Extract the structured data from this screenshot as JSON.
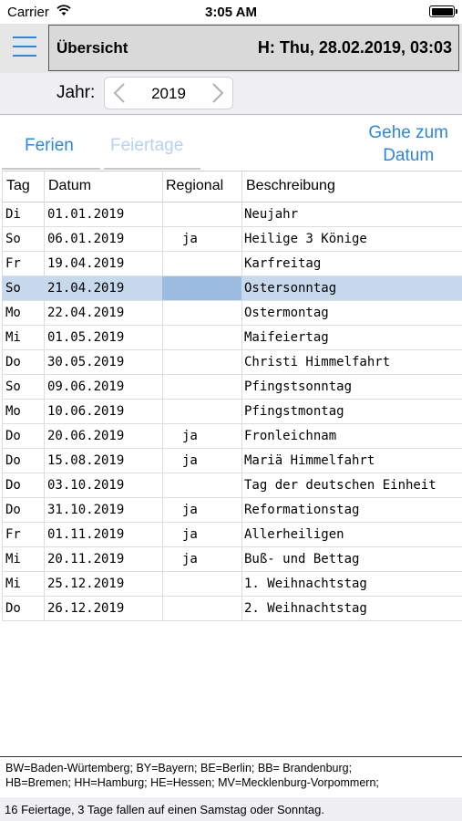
{
  "status": {
    "carrier": "Carrier",
    "time": "3:05 AM"
  },
  "header": {
    "title": "Übersicht",
    "datetime": "H: Thu, 28.02.2019, 03:03"
  },
  "year": {
    "label": "Jahr:",
    "value": "2019"
  },
  "tabs": {
    "ferien": "Ferien",
    "feiertage": "Feiertage",
    "goto_line1": "Gehe zum",
    "goto_line2": "Datum"
  },
  "table": {
    "headers": [
      "Tag",
      "Datum",
      "Regional",
      "Beschreibung"
    ],
    "rows": [
      {
        "tag": "Di",
        "datum": "01.01.2019",
        "regional": "",
        "beschreibung": "Neujahr"
      },
      {
        "tag": "So",
        "datum": "06.01.2019",
        "regional": "ja",
        "beschreibung": "Heilige 3 Könige"
      },
      {
        "tag": "Fr",
        "datum": "19.04.2019",
        "regional": "",
        "beschreibung": "Karfreitag"
      },
      {
        "tag": "So",
        "datum": "21.04.2019",
        "regional": "",
        "beschreibung": "Ostersonntag"
      },
      {
        "tag": "Mo",
        "datum": "22.04.2019",
        "regional": "",
        "beschreibung": "Ostermontag"
      },
      {
        "tag": "Mi",
        "datum": "01.05.2019",
        "regional": "",
        "beschreibung": "Maifeiertag"
      },
      {
        "tag": "Do",
        "datum": "30.05.2019",
        "regional": "",
        "beschreibung": "Christi Himmelfahrt"
      },
      {
        "tag": "So",
        "datum": "09.06.2019",
        "regional": "",
        "beschreibung": "Pfingstsonntag"
      },
      {
        "tag": "Mo",
        "datum": "10.06.2019",
        "regional": "",
        "beschreibung": "Pfingstmontag"
      },
      {
        "tag": "Do",
        "datum": "20.06.2019",
        "regional": "ja",
        "beschreibung": "Fronleichnam"
      },
      {
        "tag": "Do",
        "datum": "15.08.2019",
        "regional": "ja",
        "beschreibung": "Mariä Himmelfahrt"
      },
      {
        "tag": "Do",
        "datum": "03.10.2019",
        "regional": "",
        "beschreibung": "Tag der deutschen Einheit"
      },
      {
        "tag": "Do",
        "datum": "31.10.2019",
        "regional": "ja",
        "beschreibung": "Reformationstag"
      },
      {
        "tag": "Fr",
        "datum": "01.11.2019",
        "regional": "ja",
        "beschreibung": "Allerheiligen"
      },
      {
        "tag": "Mi",
        "datum": "20.11.2019",
        "regional": "ja",
        "beschreibung": "Buß- und Bettag"
      },
      {
        "tag": "Mi",
        "datum": "25.12.2019",
        "regional": "",
        "beschreibung": "1. Weihnachtstag"
      },
      {
        "tag": "Do",
        "datum": "26.12.2019",
        "regional": "",
        "beschreibung": "2. Weihnachtstag"
      }
    ],
    "selected_row": 3
  },
  "legend": {
    "line1": "BW=Baden-Würtemberg; BY=Bayern; BE=Berlin; BB= Brandenburg;",
    "line2": "HB=Bremen; HH=Hamburg; HE=Hessen; MV=Mecklenburg-Vorpommern;"
  },
  "summary": "16 Feiertage, 3 Tage fallen auf einen Samstag oder Sonntag.",
  "colors": {
    "accent": "#2b86e6",
    "disabled_tab": "#b6d2f2",
    "selected_row": "#c7d9ec",
    "selected_cell": "#9bbbe0"
  },
  "icons": [
    "wifi-icon",
    "battery-icon",
    "hamburger-menu-icon",
    "chevron-left-icon",
    "chevron-right-icon"
  ]
}
